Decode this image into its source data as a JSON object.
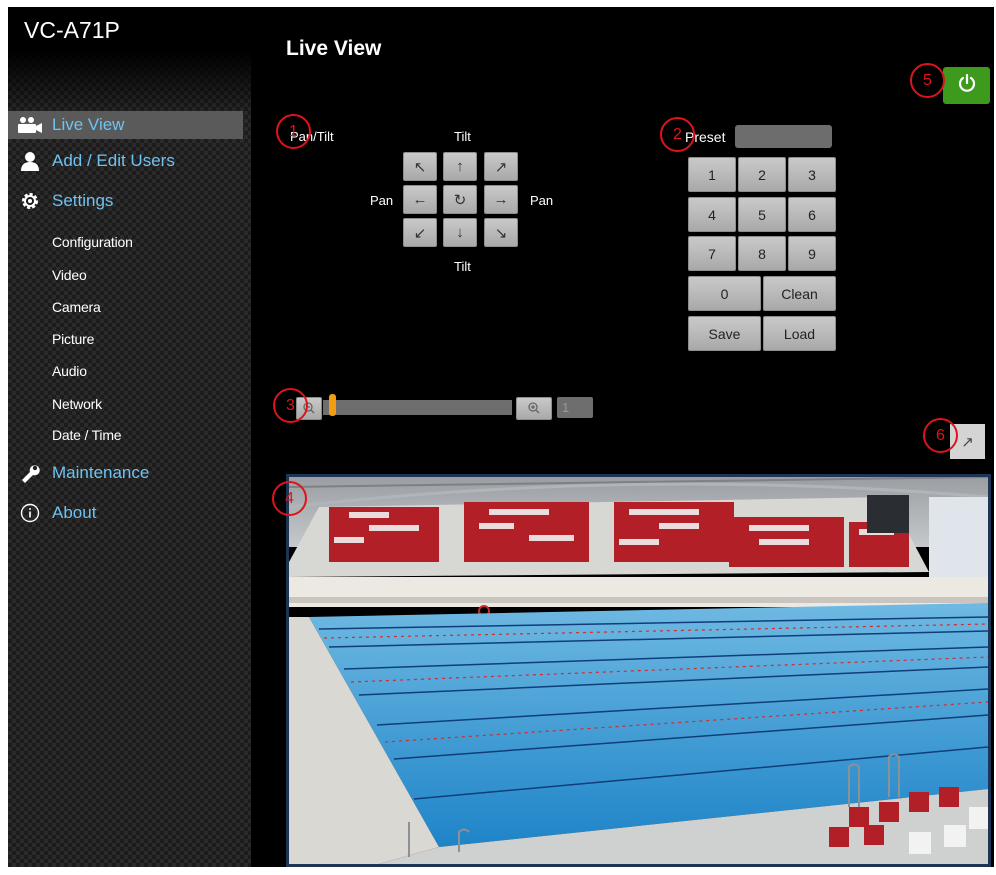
{
  "app": {
    "model": "VC-A71P",
    "page_title": "Live View"
  },
  "sidebar": {
    "main": [
      {
        "label": "Live View",
        "icon": "camera-icon"
      },
      {
        "label": "Add / Edit Users",
        "icon": "user-icon"
      },
      {
        "label": "Settings",
        "icon": "gear-icon"
      },
      {
        "label": "Maintenance",
        "icon": "wrench-icon"
      },
      {
        "label": "About",
        "icon": "info-icon"
      }
    ],
    "settings_sub": [
      "Configuration",
      "Video",
      "Camera",
      "Picture",
      "Audio",
      "Network",
      "Date / Time"
    ],
    "active": "Live View"
  },
  "ptz": {
    "title": "Pan/Tilt",
    "tilt_label": "Tilt",
    "pan_label": "Pan",
    "buttons": {
      "up_left": "↖",
      "up": "↑",
      "up_right": "↗",
      "left": "←",
      "home": "↻",
      "right": "→",
      "down_left": "↙",
      "down": "↓",
      "down_right": "↘"
    }
  },
  "preset": {
    "label": "Preset",
    "value": "",
    "keys": [
      "1",
      "2",
      "3",
      "4",
      "5",
      "6",
      "7",
      "8",
      "9",
      "0"
    ],
    "clean_label": "Clean",
    "save_label": "Save",
    "load_label": "Load"
  },
  "zoom": {
    "value": "1",
    "level_fraction": 0.0
  },
  "callouts": [
    "1",
    "2",
    "3",
    "4",
    "5",
    "6"
  ],
  "colors": {
    "accent": "#6fc3f2",
    "power": "#3d9a1c",
    "callout": "#e0131a",
    "zoom_thumb": "#f39c12"
  }
}
